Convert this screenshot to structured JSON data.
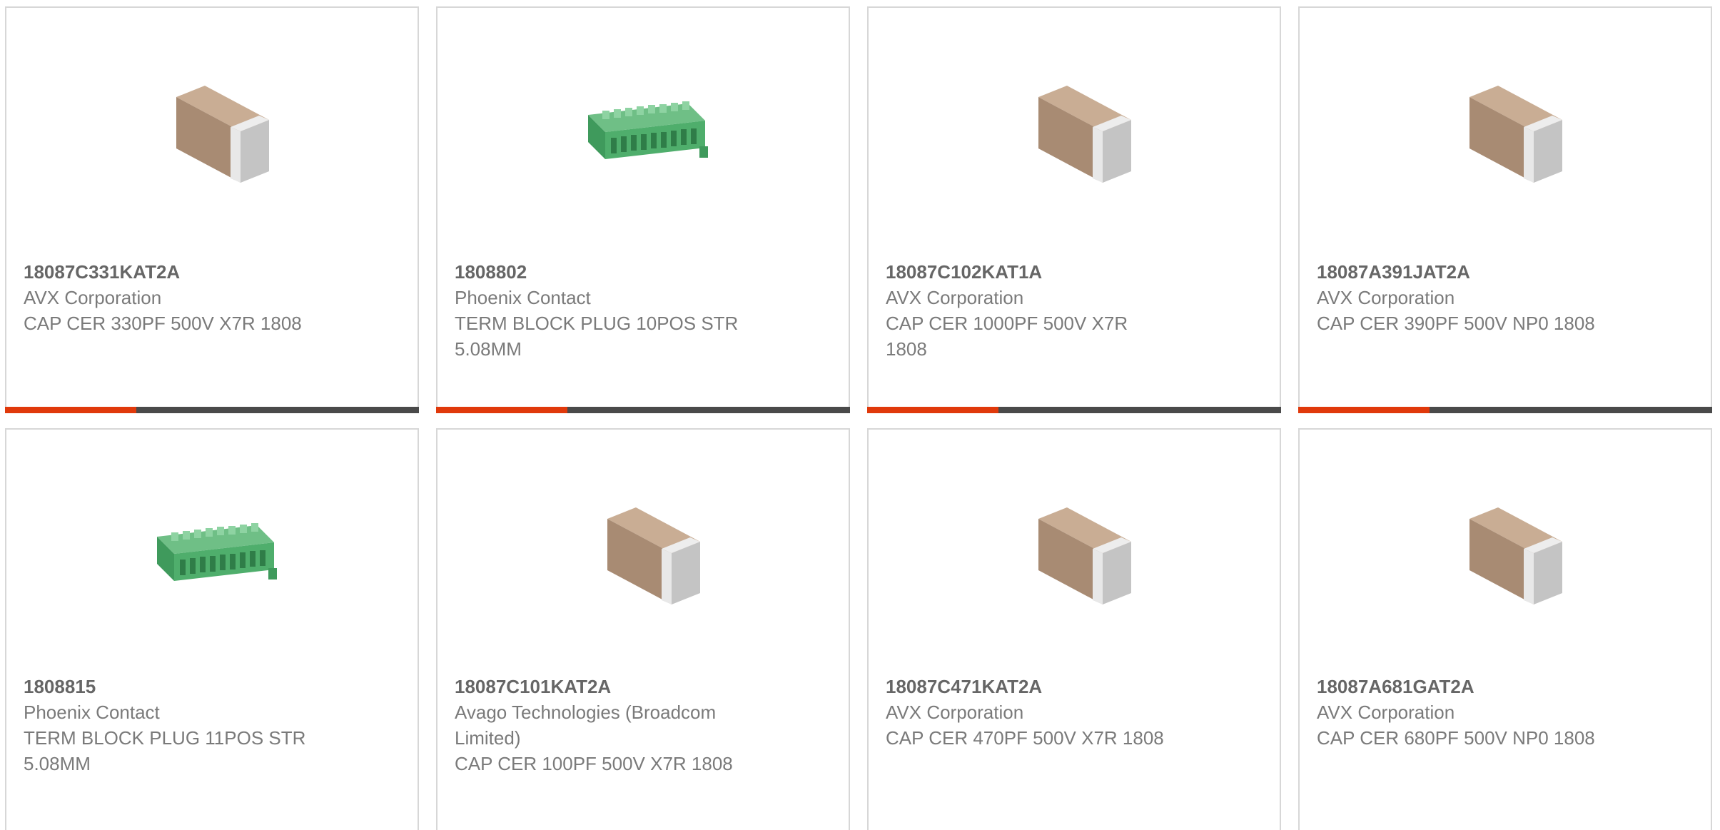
{
  "accent_color": "#e0390b",
  "bar_color": "#4a4a4a",
  "products": [
    {
      "part": "18087C331KAT2A",
      "manufacturer": "AVX Corporation",
      "description": "CAP CER 330PF 500V X7R 1808",
      "image": "ceramic-capacitor-icon"
    },
    {
      "part": "1808802",
      "manufacturer": "Phoenix Contact",
      "description": "TERM BLOCK PLUG 10POS STR 5.08MM",
      "image": "terminal-block-icon"
    },
    {
      "part": "18087C102KAT1A",
      "manufacturer": "AVX Corporation",
      "description": "CAP CER 1000PF 500V X7R 1808",
      "image": "ceramic-capacitor-icon"
    },
    {
      "part": "18087A391JAT2A",
      "manufacturer": "AVX Corporation",
      "description": "CAP CER 390PF 500V NP0 1808",
      "image": "ceramic-capacitor-icon"
    },
    {
      "part": "1808815",
      "manufacturer": "Phoenix Contact",
      "description": "TERM BLOCK PLUG 11POS STR 5.08MM",
      "image": "terminal-block-icon"
    },
    {
      "part": "18087C101KAT2A",
      "manufacturer": "Avago Technologies (Broadcom Limited)",
      "description": "CAP CER 100PF 500V X7R 1808",
      "image": "ceramic-capacitor-icon"
    },
    {
      "part": "18087C471KAT2A",
      "manufacturer": "AVX Corporation",
      "description": "CAP CER 470PF 500V X7R 1808",
      "image": "ceramic-capacitor-icon"
    },
    {
      "part": "18087A681GAT2A",
      "manufacturer": "AVX Corporation",
      "description": "CAP CER 680PF 500V NP0 1808",
      "image": "ceramic-capacitor-icon"
    }
  ]
}
